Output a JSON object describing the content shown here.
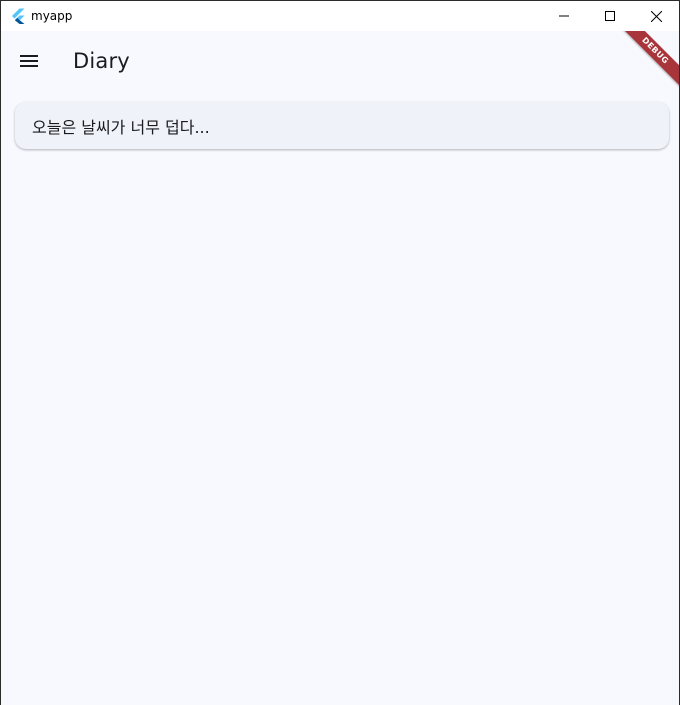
{
  "window": {
    "title": "myapp"
  },
  "appbar": {
    "menu_icon": "hamburger-menu-icon",
    "title": "Diary"
  },
  "debug_banner": {
    "label": "DEBUG",
    "color": "#a8353a"
  },
  "entries": [
    {
      "text": "오늘은 날씨가 너무 덥다..."
    }
  ],
  "colors": {
    "background": "#f7f9ff",
    "card": "#eff2f8",
    "flutter_blue_light": "#54c5f8",
    "flutter_blue_dark": "#01579b"
  }
}
